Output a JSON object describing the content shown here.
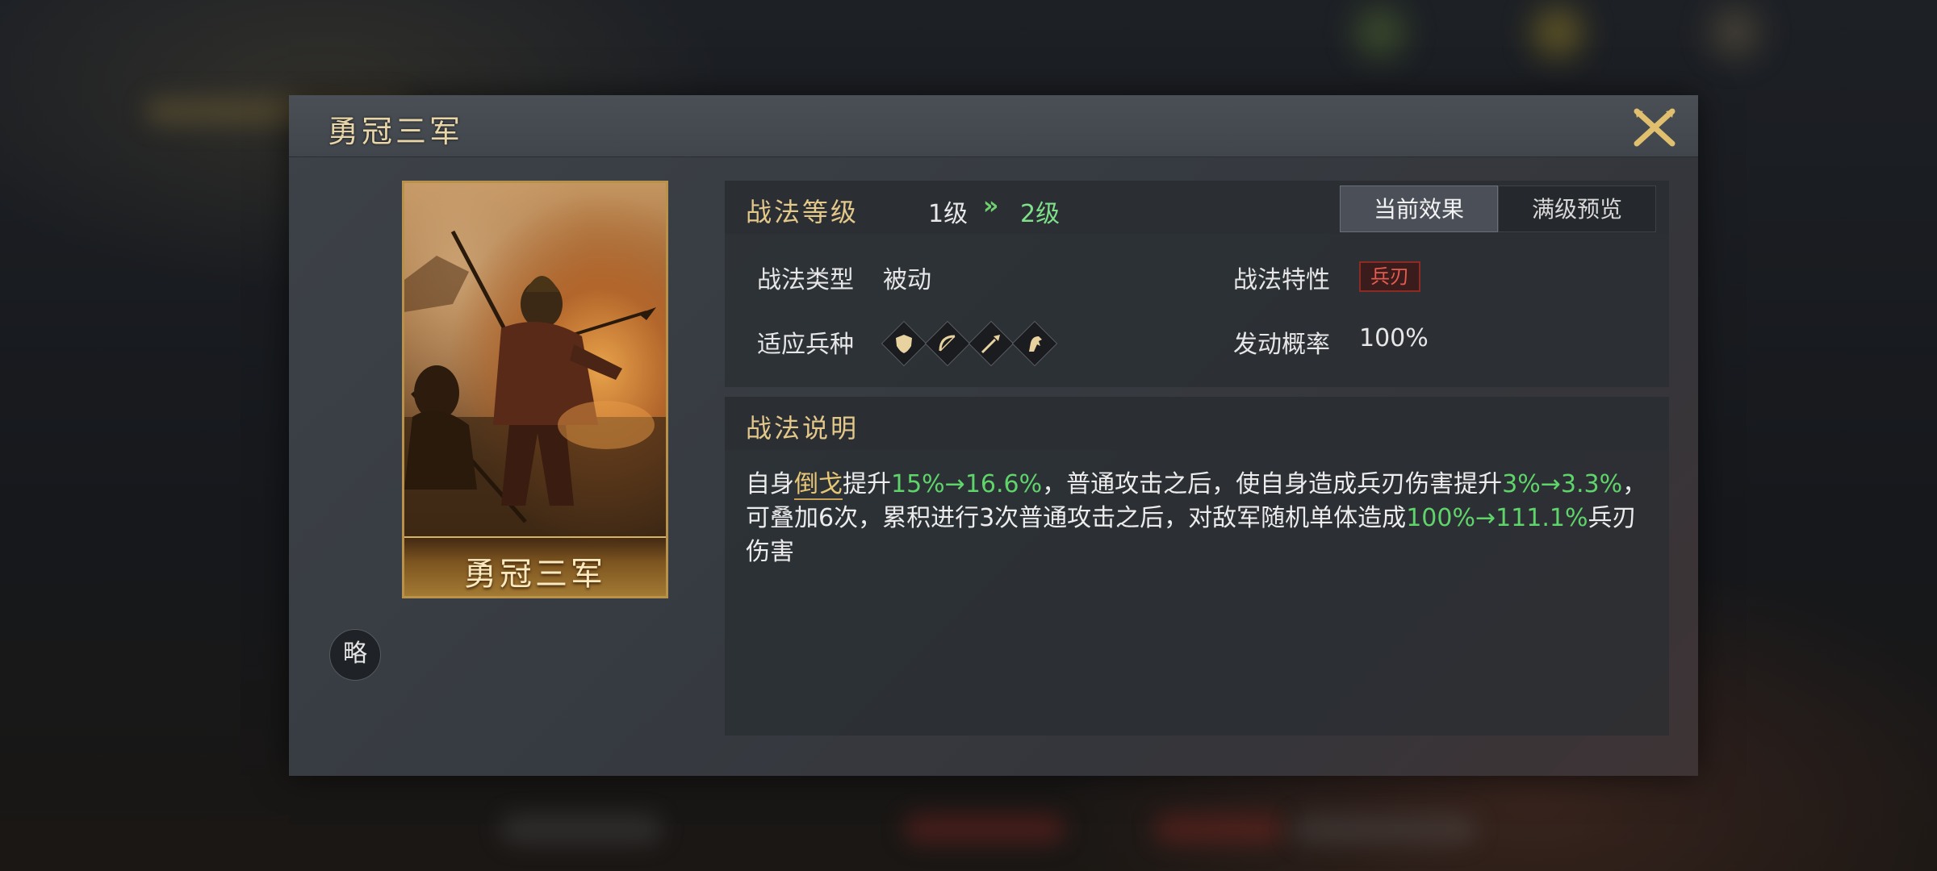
{
  "dialog": {
    "title": "勇冠三军",
    "close_icon": "close-crossed-swords-icon"
  },
  "card": {
    "name": "勇冠三军"
  },
  "badge": {
    "label": "略"
  },
  "level": {
    "label": "战法等级",
    "from": "1级",
    "arrow": "»",
    "to": "2级"
  },
  "tabs": {
    "current": "当前效果",
    "max": "满级预览"
  },
  "attributes": {
    "type_label": "战法类型",
    "type_value": "被动",
    "trait_label": "战法特性",
    "trait_value": "兵刃",
    "troops_label": "适应兵种",
    "troops": [
      "shield-icon",
      "bow-icon",
      "spear-icon",
      "cavalry-icon"
    ],
    "chance_label": "发动概率",
    "chance_value": "100%"
  },
  "description": {
    "title": "战法说明",
    "seg1": "自身",
    "seg2": "倒戈",
    "seg3": "提升",
    "seg4": "15%→16.6%",
    "seg5": "，普通攻击之后，使自身造成兵刃伤害提升",
    "seg6": "3%→3.3%",
    "seg7": "，可叠加6次，累积进行3次普通攻击之后，对敌军随机单体造成",
    "seg8": "100%→111.1%",
    "seg9": "兵刃伤害"
  },
  "colors": {
    "accent_gold": "#e3c88a",
    "upgrade_green": "#5fd46a",
    "trait_red": "#e55b4d"
  }
}
